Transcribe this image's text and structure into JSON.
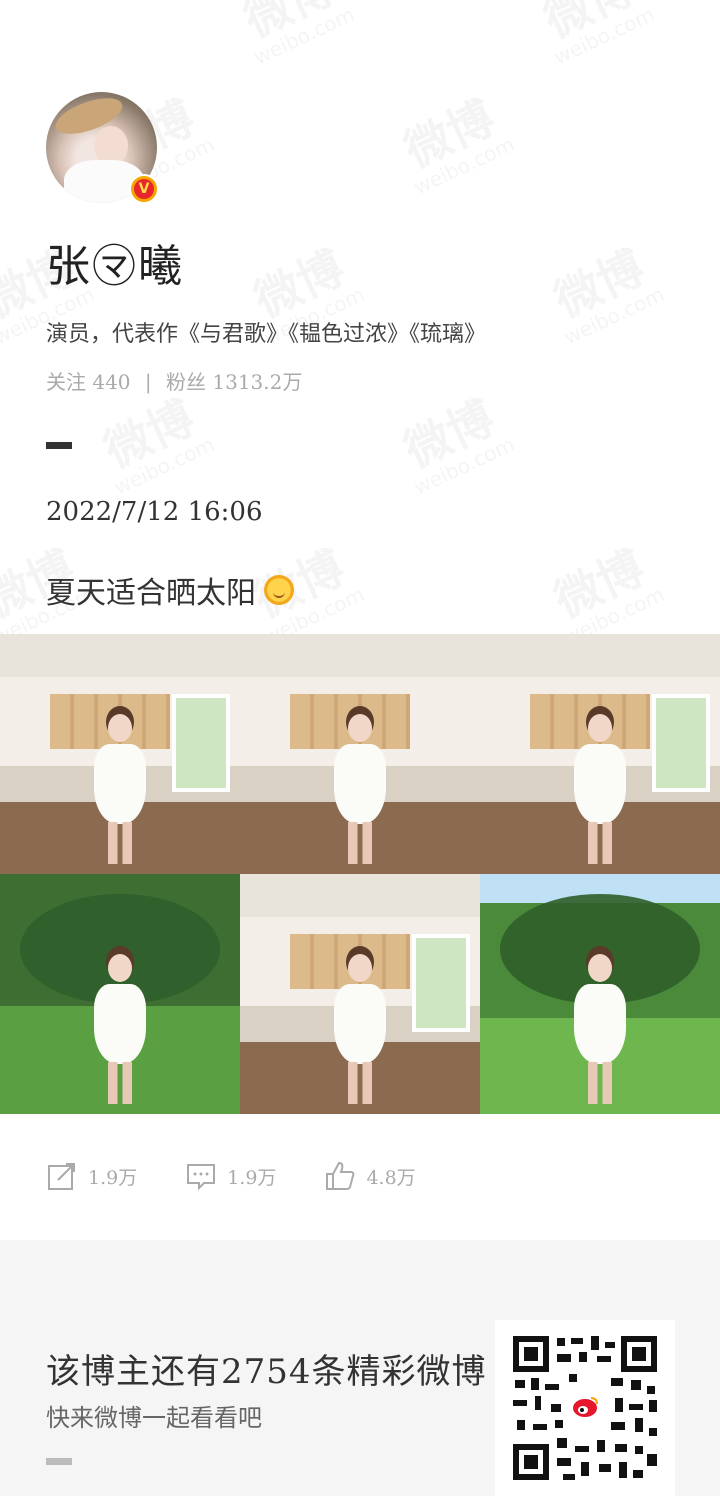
{
  "profile": {
    "name": "张㋮曦",
    "bio": "演员，代表作《与君歌》《韫色过浓》《琉璃》",
    "following_label": "关注",
    "following_count": "440",
    "followers_label": "粉丝",
    "followers_count": "1313.2万",
    "verified_badge": "V"
  },
  "post": {
    "time": "2022/7/12 16:06",
    "text": "夏天适合晒太阳",
    "emoji": "sun-emoji",
    "photos": [
      {
        "kind": "kitchen"
      },
      {
        "kind": "kitchen"
      },
      {
        "kind": "kitchen"
      },
      {
        "kind": "garden"
      },
      {
        "kind": "kitchen"
      },
      {
        "kind": "garden"
      }
    ]
  },
  "actions": {
    "repost_count": "1.9万",
    "comment_count": "1.9万",
    "like_count": "4.8万"
  },
  "footer": {
    "title": "该博主还有2754条精彩微博",
    "subtitle": "快来微博一起看看吧"
  },
  "watermark": {
    "cn": "微博",
    "en": "weibo.com"
  },
  "colors": {
    "verified_outer": "#f7a600",
    "verified_inner": "#e8262b",
    "footer_bg": "#f5f5f5",
    "muted_text": "#aaaaaa"
  }
}
